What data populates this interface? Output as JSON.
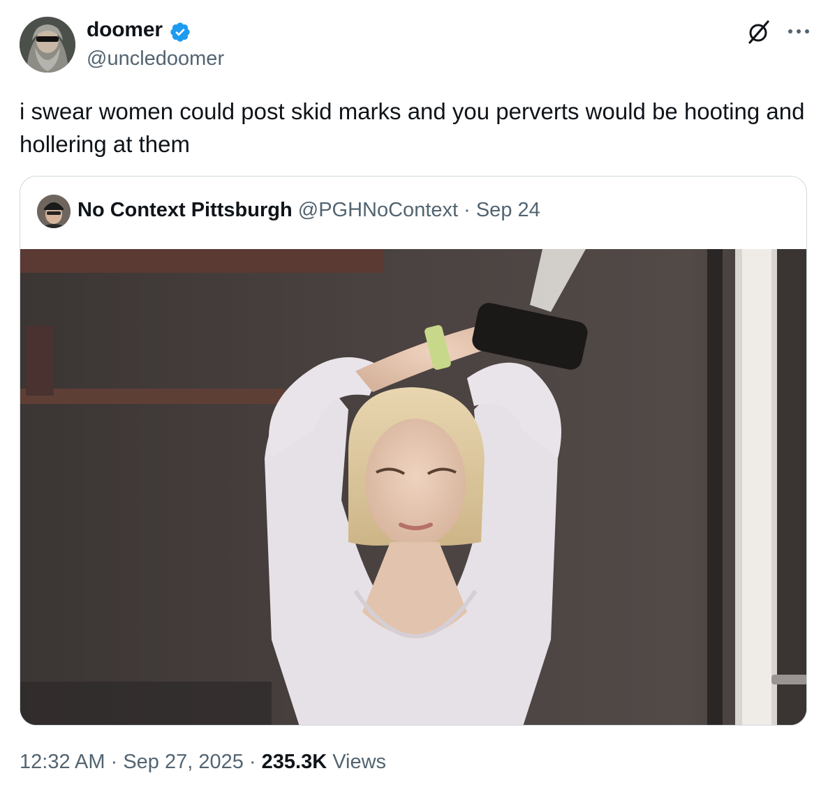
{
  "author": {
    "display_name": "doomer",
    "handle": "@uncledoomer",
    "verified_icon": "verified-badge-icon",
    "avatar_icon": "bearded-man-sunglasses-avatar"
  },
  "actions": {
    "grok_icon": "grok-icon",
    "more_icon": "more-options-icon"
  },
  "tweet": {
    "text": "i swear women could post skid marks and you perverts would be hooting and hollering at them"
  },
  "quote": {
    "display_name": "No Context Pittsburgh",
    "handle": "@PGHNoContext",
    "separator": " · ",
    "date": "Sep 24",
    "avatar_icon": "man-beanie-avatar",
    "image_description_icon": "photo-woman-arms-raised-stadium-box"
  },
  "meta": {
    "time": "12:32 AM",
    "sep1": " · ",
    "date": "Sep 27, 2025",
    "sep2": " · ",
    "views_count": "235.3K",
    "views_label": "Views"
  },
  "colors": {
    "text_primary": "#0f1419",
    "text_secondary": "#536471",
    "verified_blue": "#1d9bf0",
    "border": "#cfd9de"
  }
}
